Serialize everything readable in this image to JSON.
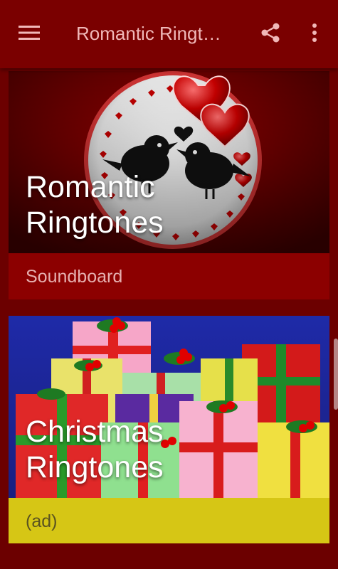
{
  "app_bar": {
    "title": "Romantic Ringt…",
    "menu_icon": "menu-icon",
    "share_icon": "share-icon",
    "more_icon": "more-vert-icon",
    "color": "#7a0000"
  },
  "cards": [
    {
      "title_line1": "Romantic",
      "title_line2": "Ringtones",
      "footer_label": "Soundboard",
      "footer_color": "#8c0000",
      "footer_text_color": "#e6b0b0",
      "image": "romantic-lovebirds-hearts"
    },
    {
      "title_line1": "Christmas",
      "title_line2": "Ringtones",
      "footer_label": "(ad)",
      "footer_color": "#d6c615",
      "footer_text_color": "#5a5320",
      "image": "christmas-gift-boxes"
    }
  ],
  "colors": {
    "background": "#6f0000",
    "caption": "#ffffff"
  }
}
